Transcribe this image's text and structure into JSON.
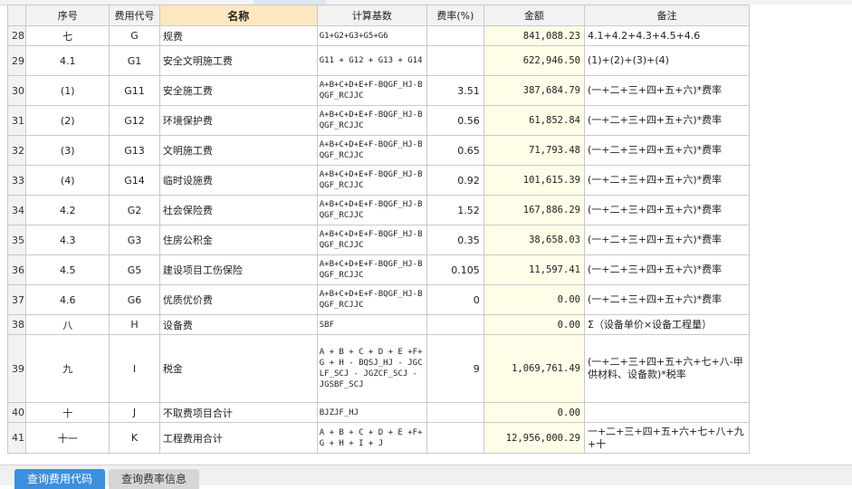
{
  "headers": {
    "seq": "序号",
    "code": "费用代号",
    "name": "名称",
    "basis": "计算基数",
    "rate": "费率(%)",
    "amount": "金额",
    "note": "备注"
  },
  "rows": [
    {
      "n": "28",
      "seq": "七",
      "code": "G",
      "name": "规费",
      "basis": "G1+G2+G3+G5+G6",
      "rate": "",
      "amount": "841,088.23",
      "note": "4.1+4.2+4.3+4.5+4.6"
    },
    {
      "n": "29",
      "seq": "4.1",
      "code": "G1",
      "name": "安全文明施工费",
      "basis": "G11 + G12 + G13 + G14",
      "rate": "",
      "amount": "622,946.50",
      "note": "(1)+(2)+(3)+(4)"
    },
    {
      "n": "30",
      "seq": "(1)",
      "code": "G11",
      "name": "安全施工费",
      "basis": "A+B+C+D+E+F-BQGF_HJ-BQGF_RCJJC",
      "rate": "3.51",
      "amount": "387,684.79",
      "note": "(一+二+三+四+五+六)*费率"
    },
    {
      "n": "31",
      "seq": "(2)",
      "code": "G12",
      "name": "环境保护费",
      "basis": "A+B+C+D+E+F-BQGF_HJ-BQGF_RCJJC",
      "rate": "0.56",
      "amount": "61,852.84",
      "note": "(一+二+三+四+五+六)*费率"
    },
    {
      "n": "32",
      "seq": "(3)",
      "code": "G13",
      "name": "文明施工费",
      "basis": "A+B+C+D+E+F-BQGF_HJ-BQGF_RCJJC",
      "rate": "0.65",
      "amount": "71,793.48",
      "note": "(一+二+三+四+五+六)*费率"
    },
    {
      "n": "33",
      "seq": "(4)",
      "code": "G14",
      "name": "临时设施费",
      "basis": "A+B+C+D+E+F-BQGF_HJ-BQGF_RCJJC",
      "rate": "0.92",
      "amount": "101,615.39",
      "note": "(一+二+三+四+五+六)*费率"
    },
    {
      "n": "34",
      "seq": "4.2",
      "code": "G2",
      "name": "社会保险费",
      "basis": "A+B+C+D+E+F-BQGF_HJ-BQGF_RCJJC",
      "rate": "1.52",
      "amount": "167,886.29",
      "note": "(一+二+三+四+五+六)*费率"
    },
    {
      "n": "35",
      "seq": "4.3",
      "code": "G3",
      "name": "住房公积金",
      "basis": "A+B+C+D+E+F-BQGF_HJ-BQGF_RCJJC",
      "rate": "0.35",
      "amount": "38,658.03",
      "note": "(一+二+三+四+五+六)*费率"
    },
    {
      "n": "36",
      "seq": "4.5",
      "code": "G5",
      "name": "建设项目工伤保险",
      "basis": "A+B+C+D+E+F-BQGF_HJ-BQGF_RCJJC",
      "rate": "0.105",
      "amount": "11,597.41",
      "note": "(一+二+三+四+五+六)*费率"
    },
    {
      "n": "37",
      "seq": "4.6",
      "code": "G6",
      "name": "优质优价费",
      "basis": "A+B+C+D+E+F-BQGF_HJ-BQGF_RCJJC",
      "rate": "0",
      "amount": "0.00",
      "note": "(一+二+三+四+五+六)*费率"
    },
    {
      "n": "38",
      "seq": "八",
      "code": "H",
      "name": "设备费",
      "basis": "SBF",
      "rate": "",
      "amount": "0.00",
      "note": "Σ（设备单价×设备工程量）"
    },
    {
      "n": "39",
      "seq": "九",
      "code": "I",
      "name": "税金",
      "basis": "A + B + C + D + E +F+ G + H - BQSJ_HJ - JGCLF_SCJ - JGZCF_SCJ - JGSBF_SCJ",
      "rate": "9",
      "amount": "1,069,761.49",
      "note": "(一+二+三+四+五+六+七+八-甲供材料、设备款)*税率"
    },
    {
      "n": "40",
      "seq": "十",
      "code": "J",
      "name": "不取费项目合计",
      "basis": "BJZJF_HJ",
      "rate": "",
      "amount": "0.00",
      "note": ""
    },
    {
      "n": "41",
      "seq": "十一",
      "code": "K",
      "name": "工程费用合计",
      "basis": "A + B + C + D + E +F+ G + H + I + J",
      "rate": "",
      "amount": "12,956,000.29",
      "note": "一+二+三+四+五+六+七+八+九+十"
    }
  ],
  "buttons": {
    "query_code": "查询费用代码",
    "query_rate": "查询费率信息"
  }
}
